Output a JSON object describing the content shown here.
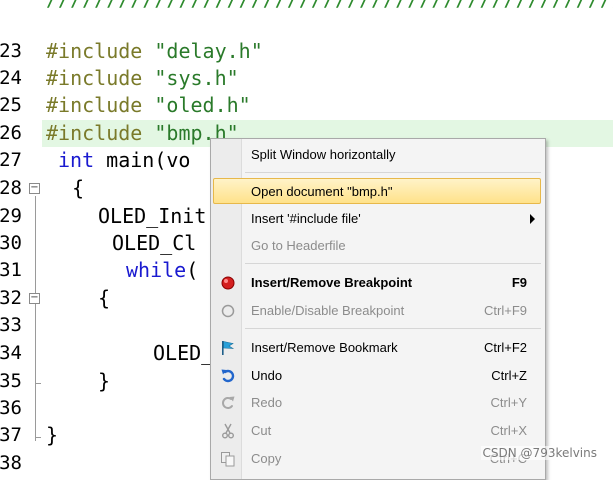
{
  "editor": {
    "top_comment": "//////////////////////////////////////////////////////////////////////////",
    "lines": [
      {
        "num": "23",
        "pp": "#include",
        "str": "\"delay.h\""
      },
      {
        "num": "24",
        "pp": "#include",
        "str": "\"sys.h\""
      },
      {
        "num": "25",
        "pp": "#include",
        "str": "\"oled.h\""
      },
      {
        "num": "26",
        "pp": "#include",
        "str": "\"bmp.h\""
      },
      {
        "num": "27",
        "kw": "int",
        "text": "main(vo"
      },
      {
        "num": "28",
        "text": "{"
      },
      {
        "num": "29",
        "text": "OLED_Init"
      },
      {
        "num": "30",
        "text": "OLED_Cl"
      },
      {
        "num": "31",
        "kw": "while",
        "text": "("
      },
      {
        "num": "32",
        "text": "{"
      },
      {
        "num": "33",
        "text": ""
      },
      {
        "num": "34",
        "text": "OLED_"
      },
      {
        "num": "35",
        "text": "}"
      },
      {
        "num": "36",
        "text": ""
      },
      {
        "num": "37",
        "text": "}"
      },
      {
        "num": "38",
        "text": ""
      }
    ],
    "fold_marker": "−"
  },
  "context_menu": {
    "items": [
      {
        "label": "Split Window horizontally",
        "shortcut": "",
        "icon": "",
        "disabled": false
      },
      {
        "label": "Open document \"bmp.h\"",
        "shortcut": "",
        "icon": "",
        "disabled": false,
        "highlighted": true
      },
      {
        "label": "Insert '#include file'",
        "shortcut": "",
        "icon": "",
        "disabled": false,
        "submenu": true
      },
      {
        "label": "Go to Headerfile",
        "shortcut": "",
        "icon": "",
        "disabled": true
      },
      {
        "label": "Insert/Remove Breakpoint",
        "shortcut": "F9",
        "icon": "breakpoint-icon",
        "disabled": false,
        "bold": true
      },
      {
        "label": "Enable/Disable Breakpoint",
        "shortcut": "Ctrl+F9",
        "icon": "breakpoint-disabled-icon",
        "disabled": true
      },
      {
        "label": "Insert/Remove Bookmark",
        "shortcut": "Ctrl+F2",
        "icon": "bookmark-flag-icon",
        "disabled": false
      },
      {
        "label": "Undo",
        "shortcut": "Ctrl+Z",
        "icon": "undo-icon",
        "disabled": false
      },
      {
        "label": "Redo",
        "shortcut": "Ctrl+Y",
        "icon": "redo-icon",
        "disabled": true
      },
      {
        "label": "Cut",
        "shortcut": "Ctrl+X",
        "icon": "cut-icon",
        "disabled": true
      },
      {
        "label": "Copy",
        "shortcut": "Ctrl+C",
        "icon": "copy-icon",
        "disabled": true
      }
    ]
  },
  "watermark": "CSDN @793kelvins",
  "colors": {
    "preprocessor": "#7a7a2a",
    "string": "#2a7a2a",
    "keyword": "#1a1ad0",
    "current_line": "#e3f7e3",
    "menu_highlight": "#ffe28a"
  }
}
